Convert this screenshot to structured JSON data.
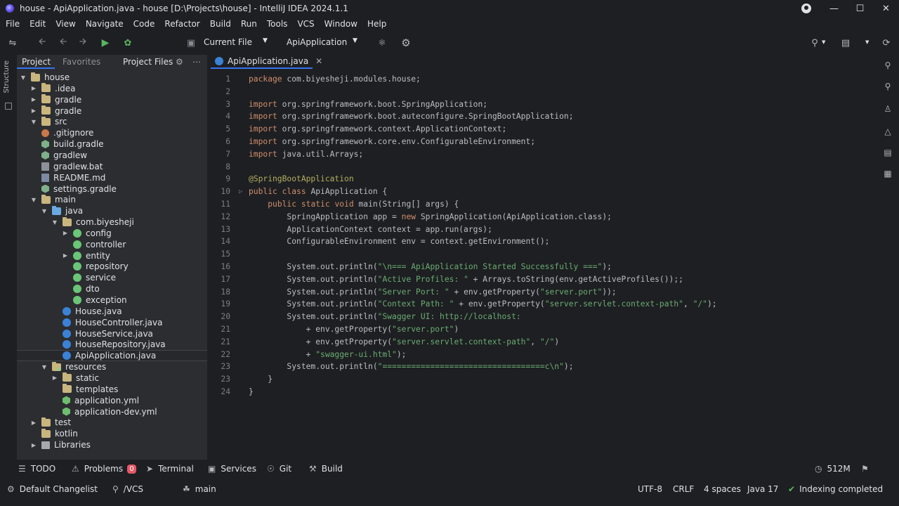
{
  "window": {
    "title": "house - ApiApplication.java - house [D:\\Projects\\house] - IntelliJ IDEA 2024.1.1"
  },
  "menu": [
    "File",
    "Edit",
    "View",
    "Navigate",
    "Code",
    "Refactor",
    "Build",
    "Run",
    "Tools",
    "VCS",
    "Window",
    "Help"
  ],
  "toolbar": {
    "run_config_scope": "Current File",
    "run_config": "ApiApplication"
  },
  "left_strip": {
    "vertical_label": "Structure"
  },
  "project_panel": {
    "tabs": [
      "Project",
      "Favorites",
      "Project Files"
    ],
    "tree": [
      {
        "label": "house",
        "depth": 0,
        "arrow": "open",
        "icon": "folder"
      },
      {
        "label": ".idea",
        "depth": 1,
        "arrow": "closed",
        "icon": "folder"
      },
      {
        "label": "gradle",
        "depth": 1,
        "arrow": "closed",
        "icon": "folder"
      },
      {
        "label": "gradle",
        "depth": 1,
        "arrow": "closed",
        "icon": "folder"
      },
      {
        "label": "src",
        "depth": 1,
        "arrow": "open",
        "icon": "folder"
      },
      {
        "label": ".gitignore",
        "depth": 1,
        "arrow": "none",
        "icon": "ignore"
      },
      {
        "label": "build.gradle",
        "depth": 1,
        "arrow": "none",
        "icon": "gradle"
      },
      {
        "label": "gradlew",
        "depth": 1,
        "arrow": "none",
        "icon": "gradle"
      },
      {
        "label": "gradlew.bat",
        "depth": 1,
        "arrow": "none",
        "icon": "bat"
      },
      {
        "label": "README.md",
        "depth": 1,
        "arrow": "none",
        "icon": "md"
      },
      {
        "label": "settings.gradle",
        "depth": 1,
        "arrow": "none",
        "icon": "gradle"
      },
      {
        "label": "main",
        "depth": 1,
        "arrow": "open",
        "icon": "folder"
      },
      {
        "label": "java",
        "depth": 2,
        "arrow": "open",
        "icon": "folder-src"
      },
      {
        "label": "com.biyesheji",
        "depth": 3,
        "arrow": "open",
        "icon": "folder"
      },
      {
        "label": "config",
        "depth": 4,
        "arrow": "closed",
        "icon": "package"
      },
      {
        "label": "controller",
        "depth": 4,
        "arrow": "none",
        "icon": "package"
      },
      {
        "label": "entity",
        "depth": 4,
        "arrow": "closed",
        "icon": "package"
      },
      {
        "label": "repository",
        "depth": 4,
        "arrow": "none",
        "icon": "package"
      },
      {
        "label": "service",
        "depth": 4,
        "arrow": "none",
        "icon": "package"
      },
      {
        "label": "dto",
        "depth": 4,
        "arrow": "none",
        "icon": "package"
      },
      {
        "label": "exception",
        "depth": 4,
        "arrow": "none",
        "icon": "package"
      },
      {
        "label": "House.java",
        "depth": 3,
        "arrow": "none",
        "icon": "java"
      },
      {
        "label": "HouseController.java",
        "depth": 3,
        "arrow": "none",
        "icon": "java"
      },
      {
        "label": "HouseService.java",
        "depth": 3,
        "arrow": "none",
        "icon": "java"
      },
      {
        "label": "HouseRepository.java",
        "depth": 3,
        "arrow": "none",
        "icon": "java"
      },
      {
        "label": "ApiApplication.java",
        "depth": 3,
        "arrow": "none",
        "icon": "java",
        "selected": true
      },
      {
        "label": "resources",
        "depth": 2,
        "arrow": "open",
        "icon": "folder-res"
      },
      {
        "label": "static",
        "depth": 3,
        "arrow": "closed",
        "icon": "folder"
      },
      {
        "label": "templates",
        "depth": 3,
        "arrow": "none",
        "icon": "folder"
      },
      {
        "label": "application.yml",
        "depth": 3,
        "arrow": "none",
        "icon": "yml"
      },
      {
        "label": "application-dev.yml",
        "depth": 3,
        "arrow": "none",
        "icon": "yml"
      },
      {
        "label": "test",
        "depth": 1,
        "arrow": "closed",
        "icon": "folder"
      },
      {
        "label": "kotlin",
        "depth": 1,
        "arrow": "none",
        "icon": "folder"
      },
      {
        "label": "Libraries",
        "depth": 1,
        "arrow": "closed",
        "icon": "lib"
      }
    ]
  },
  "editor": {
    "tab_label": "ApiApplication.java",
    "lines": [
      {
        "n": "1",
        "t": "package com.biyesheji.modules.house;"
      },
      {
        "n": "2",
        "t": ""
      },
      {
        "n": "3",
        "t": "import org.springframework.boot.SpringApplication;"
      },
      {
        "n": "4",
        "t": "import org.springframework.boot.auteconfigure.SpringBootApplication;"
      },
      {
        "n": "5",
        "t": "import org.springframework.context.ApplicationContext;"
      },
      {
        "n": "6",
        "t": "import org.springframework.core.env.ConfigurableEnvironment;"
      },
      {
        "n": "7",
        "t": "import java.util.Arrays;"
      },
      {
        "n": "8",
        "t": ""
      },
      {
        "n": "9",
        "t": "@SpringBootApplication"
      },
      {
        "n": "10",
        "t": "public class ApiApplication {"
      },
      {
        "n": "11",
        "t": "    public static void main(String[] args) {"
      },
      {
        "n": "12",
        "t": "        SpringApplication app = new SpringApplication(ApiApplication.class);"
      },
      {
        "n": "13",
        "t": "        ApplicationContext context = app.run(args);"
      },
      {
        "n": "14",
        "t": "        ConfigurableEnvironment env = context.getEnvironment();"
      },
      {
        "n": "15",
        "t": ""
      },
      {
        "n": "16",
        "t": "        System.out.println(\"\\n=== ApiApplication Started Successfully ===\");"
      },
      {
        "n": "17",
        "t": "        System.out.println(\"Active Profiles: \" + Arrays.toString(env.getActiveProfiles());;"
      },
      {
        "n": "18",
        "t": "        System.out.println(\"Server Port: \" + env.getProperty(\"server.port\"));"
      },
      {
        "n": "19",
        "t": "        System.out.println(\"Context Path: \" + env.getProperty(\"server.servlet.context-path\", \"/\");"
      },
      {
        "n": "20",
        "t": "        System.out.println(\"Swagger UI: http://localhost:"
      },
      {
        "n": "21",
        "t": "            + env.getProperty(\"server.port\")"
      },
      {
        "n": "21",
        "t": "            + env.getProperty(\"server.servlet.context-path\", \"/\")"
      },
      {
        "n": "22",
        "t": "            + \"swagger-ui.html\");"
      },
      {
        "n": "23",
        "t": "        System.out.println(\"==================================c\\n\");"
      },
      {
        "n": "23",
        "t": "    }"
      },
      {
        "n": "24",
        "t": "}"
      }
    ]
  },
  "bottom_tools": {
    "todo": "TODO",
    "problems": "Problems",
    "problems_count": "0",
    "terminal": "Terminal",
    "services": "Services",
    "git": "Git",
    "build": "Build",
    "memory": "512M"
  },
  "statusbar": {
    "changelist": "Default Changelist",
    "vcs": "/VCS",
    "branch": "main",
    "encoding": "UTF-8",
    "line_sep": "CRLF",
    "indent": "4 spaces",
    "sdk": "Java 17",
    "indexing": "Indexing completed"
  },
  "colors": {
    "accent": "#3574f0",
    "keyword": "#cf8e6d",
    "string": "#6aab73",
    "annotation": "#b3ae60"
  }
}
